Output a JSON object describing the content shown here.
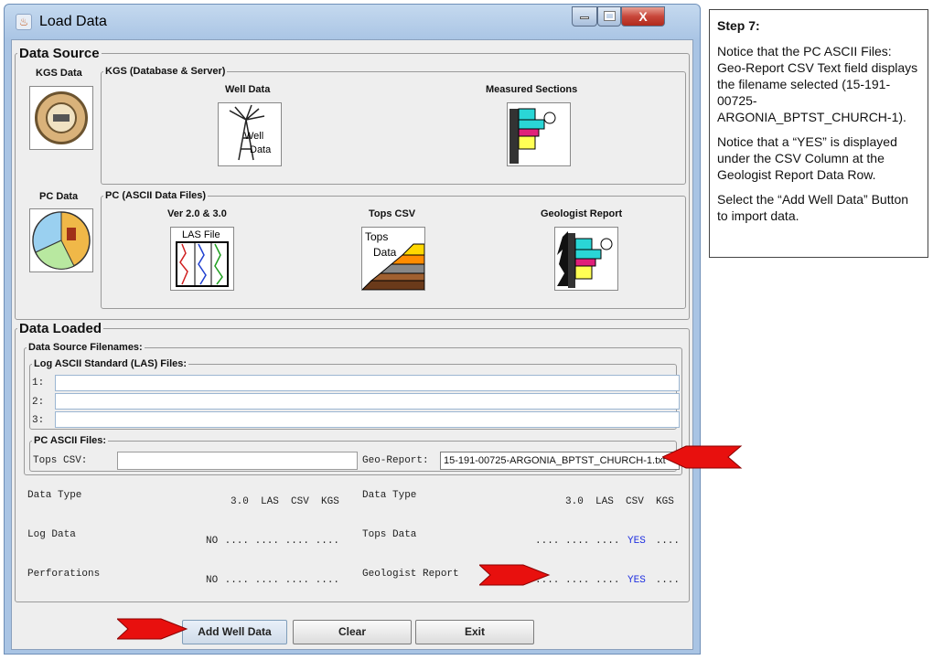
{
  "window": {
    "title": "Load Data",
    "min_label": "—",
    "max_label": "□",
    "close_label": "X"
  },
  "data_source": {
    "legend": "Data Source",
    "kgs_label": "KGS Data",
    "kgs_group": "KGS (Database & Server)",
    "well_data": "Well Data",
    "well_icon_text": [
      "Well",
      "Data"
    ],
    "measured_sections": "Measured Sections",
    "pc_label": "PC Data",
    "pc_group": "PC (ASCII Data Files)",
    "ver_label": "Ver 2.0 & 3.0",
    "las_icon_text": "LAS File",
    "tops_csv": "Tops CSV",
    "tops_icon_text": [
      "Tops",
      "Data"
    ],
    "geologist_report": "Geologist Report"
  },
  "data_loaded": {
    "legend": "Data Loaded",
    "filenames_group": "Data Source Filenames:",
    "las_group": "Log ASCII Standard (LAS) Files:",
    "las_rows": [
      "1:",
      "2:",
      "3:"
    ],
    "pc_group": "PC ASCII Files:",
    "tops_csv_label": "Tops CSV:",
    "geo_report_label": "Geo-Report:",
    "geo_report_value": "15-191-00725-ARGONIA_BPTST_CHURCH-1.txt"
  },
  "status": {
    "left": {
      "header": "Data Type",
      "cols": "3.0  LAS  CSV  KGS",
      "rows": [
        {
          "name": "Log Data",
          "prefix": "NO",
          "dots": " .... .... .... ...."
        },
        {
          "name": "Perforations",
          "prefix": "NO",
          "dots": " .... .... .... ...."
        }
      ]
    },
    "right": {
      "header": "Data Type",
      "cols": "3.0  LAS  CSV  KGS",
      "rows": [
        {
          "name": "Tops Data",
          "dots": ".... .... .... ",
          "yes": "YES",
          "tail": " ...."
        },
        {
          "name": "Geologist Report",
          "dots": ".... .... .... ",
          "yes": "YES",
          "tail": " ...."
        }
      ]
    }
  },
  "buttons": {
    "add": "Add Well Data",
    "clear": "Clear",
    "exit": "Exit"
  },
  "note": {
    "step": "Step 7:",
    "p1": "Notice that the PC ASCII Files: Geo-Report CSV Text  field displays the filename selected (15-191-00725-ARGONIA_BPTST_CHURCH-1).",
    "p2": "Notice that a “YES” is displayed under the CSV Column at the Geologist Report Data Row.",
    "p3": "Select the “Add Well Data” Button to import data."
  },
  "colors": {
    "arrow": "#e8100e",
    "yes": "#2030e0",
    "titlebar": "#b4cbe6",
    "close": "#c8463a"
  }
}
